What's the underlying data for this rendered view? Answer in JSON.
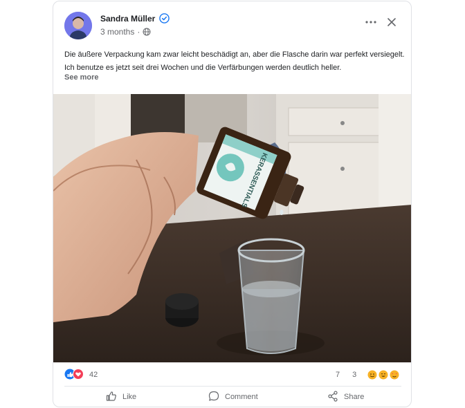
{
  "post": {
    "author": "Sandra Müller",
    "time": "3 months",
    "separator": "·",
    "text": "Die äußere Verpackung kam zwar leicht beschädigt an, aber die Flasche darin war perfekt versiegelt. Ich benutze es jetzt seit drei Wochen und die Verfärbungen werden deutlich heller.",
    "see_more": "See more",
    "bottle_label": "KERASSENTIALS"
  },
  "stats": {
    "reaction_count": "42",
    "comments": "7",
    "shares": "3"
  },
  "actions": {
    "like": "Like",
    "comment": "Comment",
    "share": "Share"
  },
  "icons": [
    "verified-icon",
    "globe-icon",
    "more-icon",
    "close-icon",
    "like-icon",
    "comment-icon",
    "share-icon"
  ],
  "colors": {
    "accent": "#1877f2",
    "love": "#f33e58",
    "text_secondary": "#65676b"
  }
}
